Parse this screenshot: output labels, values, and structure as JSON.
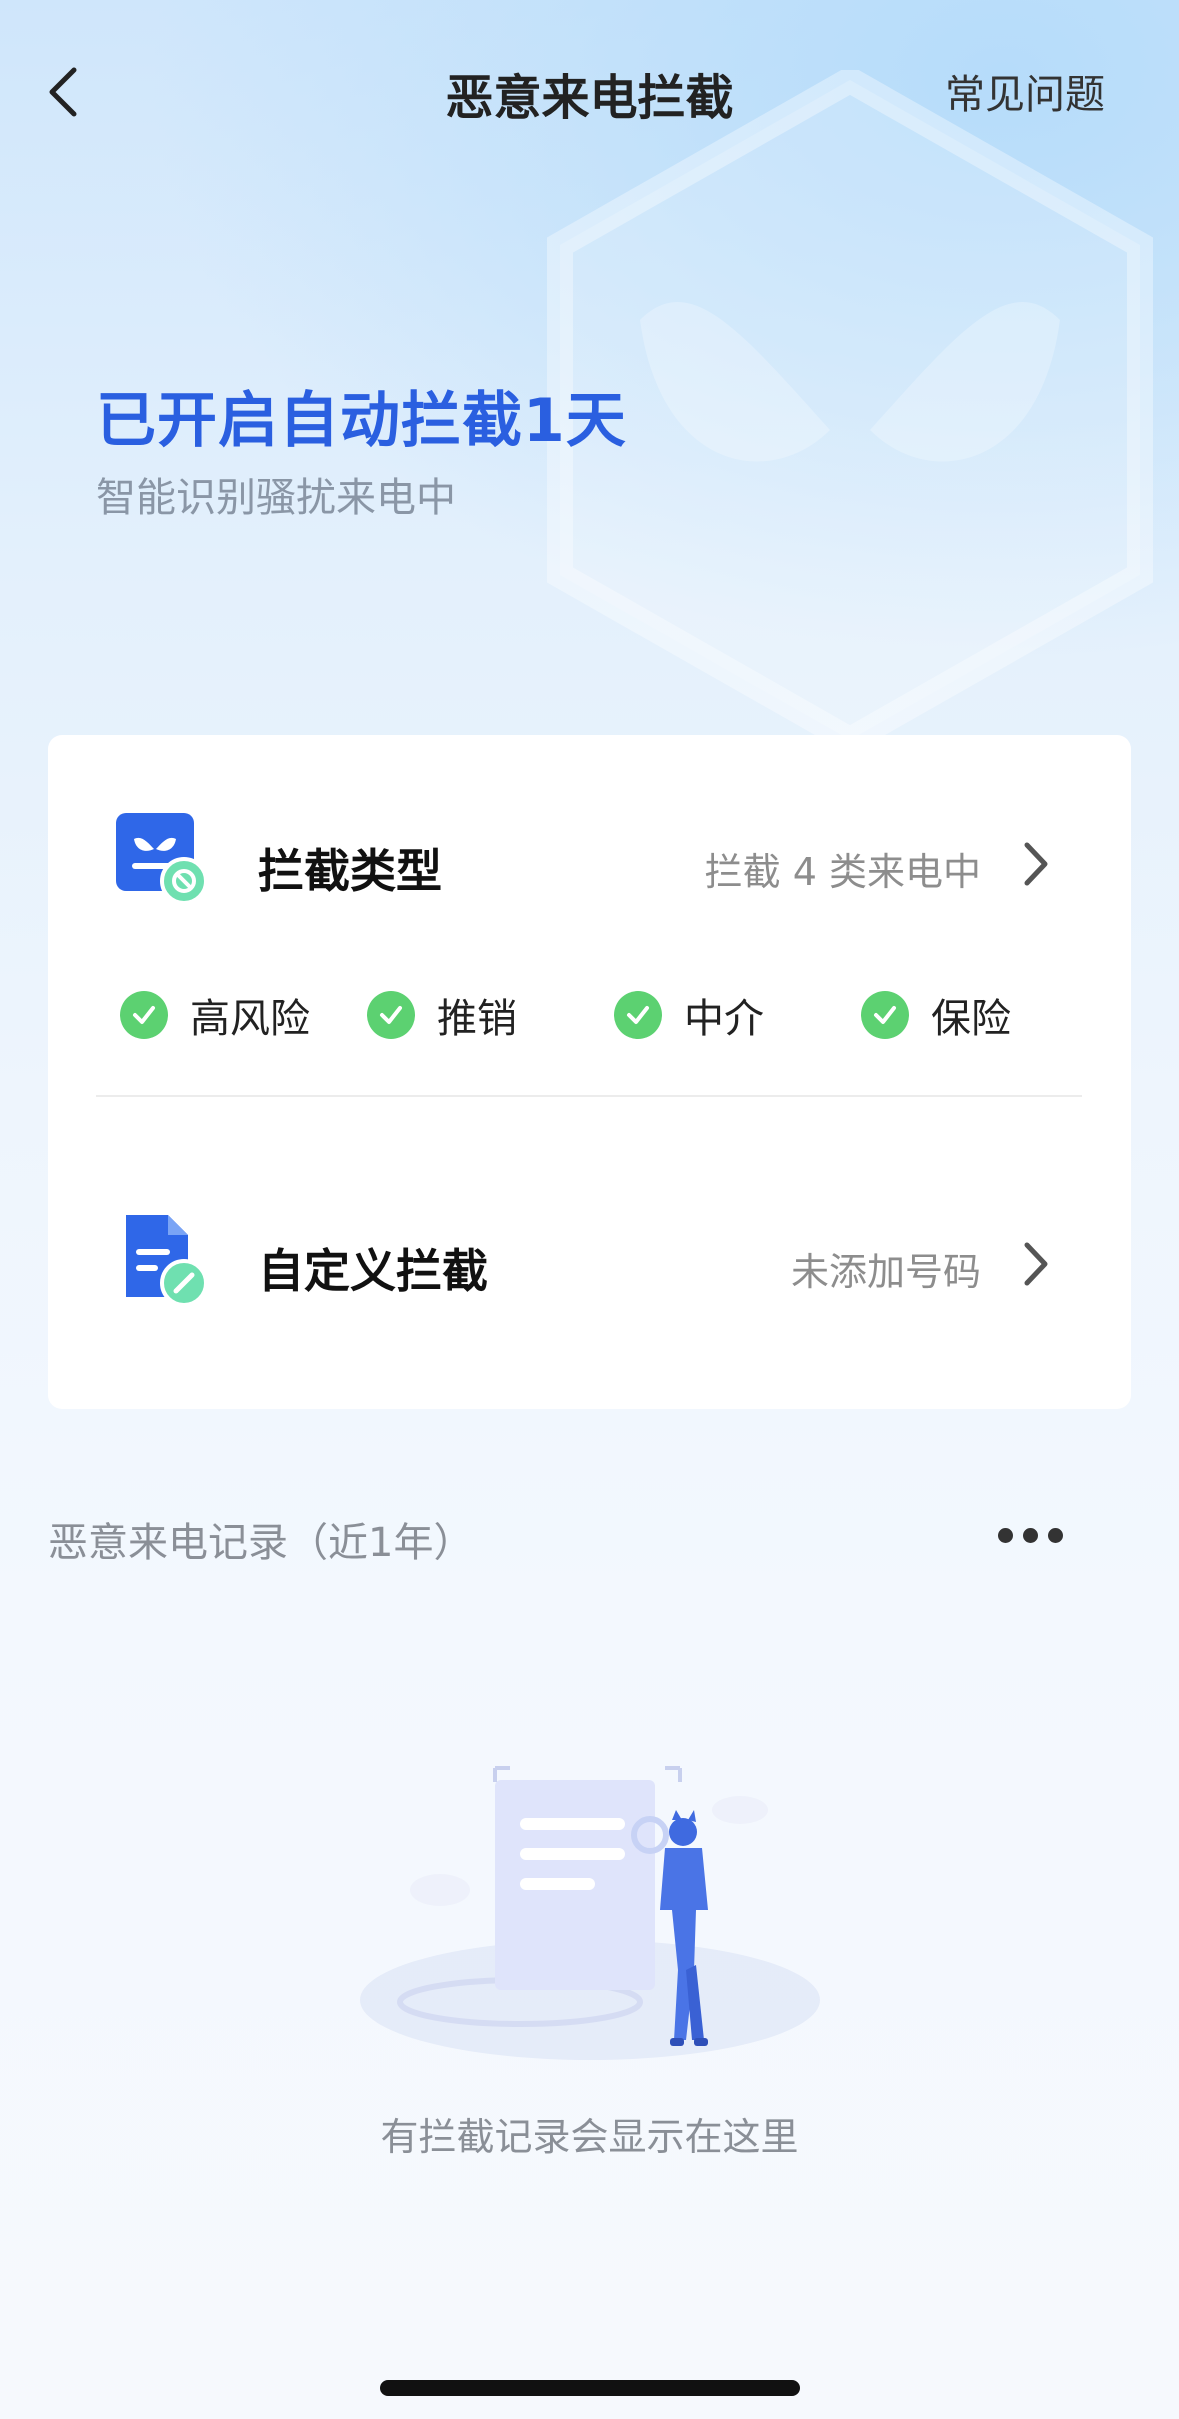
{
  "nav": {
    "title": "恶意来电拦截",
    "faq_label": "常见问题"
  },
  "status": {
    "title": "已开启自动拦截1天",
    "subtitle": "智能识别骚扰来电中"
  },
  "card": {
    "intercept_type": {
      "label": "拦截类型",
      "value": "拦截 4 类来电中"
    },
    "tags": [
      {
        "label": "高风险"
      },
      {
        "label": "推销"
      },
      {
        "label": "中介"
      },
      {
        "label": "保险"
      }
    ],
    "custom": {
      "label": "自定义拦截",
      "value": "未添加号码"
    }
  },
  "records": {
    "title": "恶意来电记录（近1年）",
    "empty_text": "有拦截记录会显示在这里"
  },
  "colors": {
    "accent": "#2a5fe0",
    "check": "#5cd171",
    "badge": "#6fe0b0"
  }
}
